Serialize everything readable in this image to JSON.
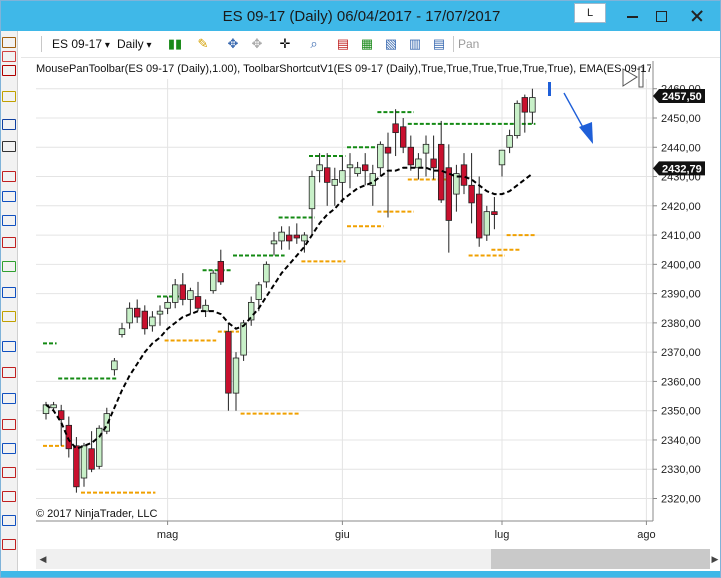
{
  "window": {
    "title": "ES 09-17 (Daily)  06/04/2017 - 17/07/2017",
    "scroll_lock_label": "L"
  },
  "toolbar": {
    "instrument": "ES 09-17",
    "interval": "Daily",
    "pan_label": "Pan"
  },
  "indicators_line": "MousePanToolbar(ES 09-17 (Daily),1.00), ToolbarShortcutV1(ES 09-17 (Daily),True,True,True,True,True,True), EMA(ES 09-17",
  "copyright": "© 2017 NinjaTrader, LLC",
  "colors": {
    "up_candle": "#c8f0c8",
    "down_candle": "#c8102e",
    "resistance": "#138a13",
    "support": "#f0a000",
    "ema": "#000000",
    "arrow": "#1f5fd8",
    "price_flag": "#111111",
    "titlebar": "#3fb8e8"
  },
  "chart_data": {
    "type": "candlestick",
    "title": "",
    "ylim": [
      2315,
      2465
    ],
    "y_ticks": [
      "2320,00",
      "2330,00",
      "2340,00",
      "2350,00",
      "2360,00",
      "2370,00",
      "2380,00",
      "2390,00",
      "2400,00",
      "2410,00",
      "2420,00",
      "2430,00",
      "2440,00",
      "2450,00",
      "2460,00"
    ],
    "x_tick_labels": [
      {
        "label": "mag",
        "index": 16
      },
      {
        "label": "giu",
        "index": 39
      },
      {
        "label": "lug",
        "index": 60
      },
      {
        "label": "ago",
        "index": 79
      }
    ],
    "price_flags": [
      {
        "label": "2457,50",
        "value": 2457.5
      },
      {
        "label": "2432,79",
        "value": 2432.79
      }
    ],
    "candles": [
      [
        2349,
        2353,
        2347,
        2352
      ],
      [
        2351,
        2353,
        2350,
        2352
      ],
      [
        2350,
        2352,
        2338,
        2347
      ],
      [
        2345,
        2348,
        2334,
        2337
      ],
      [
        2338,
        2341,
        2322,
        2324
      ],
      [
        2327,
        2339,
        2324,
        2338
      ],
      [
        2337,
        2343,
        2329,
        2330
      ],
      [
        2331,
        2345,
        2330,
        2344
      ],
      [
        2343,
        2351,
        2342,
        2349
      ],
      [
        2364,
        2368,
        2362,
        2367
      ],
      [
        2376,
        2380,
        2375,
        2378
      ],
      [
        2380,
        2387,
        2378,
        2385
      ],
      [
        2385,
        2388,
        2380,
        2382
      ],
      [
        2384,
        2386,
        2376,
        2378
      ],
      [
        2379,
        2384,
        2377,
        2382
      ],
      [
        2383,
        2386,
        2379,
        2384
      ],
      [
        2385,
        2389,
        2383,
        2387
      ],
      [
        2387,
        2395,
        2385,
        2393
      ],
      [
        2393,
        2397,
        2386,
        2388
      ],
      [
        2388,
        2392,
        2383,
        2391
      ],
      [
        2389,
        2394,
        2384,
        2385
      ],
      [
        2384,
        2388,
        2382,
        2386
      ],
      [
        2391,
        2398,
        2390,
        2397
      ],
      [
        2401,
        2405,
        2393,
        2394
      ],
      [
        2377,
        2380,
        2350,
        2356
      ],
      [
        2356,
        2370,
        2350,
        2368
      ],
      [
        2369,
        2381,
        2367,
        2380
      ],
      [
        2381,
        2389,
        2379,
        2387
      ],
      [
        2388,
        2394,
        2384,
        2393
      ],
      [
        2394,
        2401,
        2392,
        2400
      ],
      [
        2407,
        2411,
        2403,
        2408
      ],
      [
        2408,
        2413,
        2405,
        2411
      ],
      [
        2410,
        2413,
        2405,
        2408
      ],
      [
        2410,
        2414,
        2407,
        2409
      ],
      [
        2408,
        2411,
        2404,
        2410
      ],
      [
        2419,
        2432,
        2410,
        2430
      ],
      [
        2432,
        2438,
        2428,
        2434
      ],
      [
        2433,
        2438,
        2420,
        2428
      ],
      [
        2427,
        2433,
        2420,
        2429
      ],
      [
        2428,
        2437,
        2421,
        2432
      ],
      [
        2433,
        2438,
        2426,
        2434
      ],
      [
        2431,
        2435,
        2430,
        2433
      ],
      [
        2434,
        2438,
        2427,
        2432
      ],
      [
        2427,
        2434,
        2420,
        2431
      ],
      [
        2433,
        2442,
        2430,
        2441
      ],
      [
        2440,
        2445,
        2416,
        2438
      ],
      [
        2448,
        2453,
        2437,
        2445
      ],
      [
        2447,
        2450,
        2438,
        2440
      ],
      [
        2440,
        2444,
        2432,
        2434
      ],
      [
        2433,
        2438,
        2429,
        2436
      ],
      [
        2438,
        2444,
        2430,
        2441
      ],
      [
        2436,
        2444,
        2429,
        2433
      ],
      [
        2441,
        2449,
        2421,
        2422
      ],
      [
        2433,
        2441,
        2404,
        2415
      ],
      [
        2424,
        2434,
        2418,
        2431
      ],
      [
        2434,
        2438,
        2424,
        2427
      ],
      [
        2427,
        2438,
        2414,
        2421
      ],
      [
        2424,
        2430,
        2406,
        2409
      ],
      [
        2410,
        2420,
        2408,
        2418
      ],
      [
        2418,
        2423,
        2412,
        2417
      ],
      [
        2434,
        2438,
        2430,
        2439
      ],
      [
        2440,
        2446,
        2438,
        2444
      ],
      [
        2444,
        2456,
        2443,
        2455
      ],
      [
        2457,
        2458,
        2445,
        2452
      ],
      [
        2452,
        2460,
        2448,
        2457
      ]
    ],
    "ema": [
      2352,
      2350,
      2346,
      2340,
      2337,
      2338,
      2339,
      2341,
      2345,
      2351,
      2357,
      2362,
      2366,
      2370,
      2373,
      2375,
      2378,
      2380,
      2382,
      2383,
      2384,
      2384,
      2384,
      2383,
      2380,
      2378,
      2379,
      2382,
      2385,
      2389,
      2393,
      2397,
      2400,
      2403,
      2406,
      2410,
      2414,
      2417,
      2419,
      2422,
      2424,
      2426,
      2427,
      2428,
      2430,
      2432,
      2432,
      2433,
      2433,
      2433,
      2433,
      2432,
      2432,
      2431,
      2430,
      2430,
      2429,
      2427,
      2425,
      2424,
      2424,
      2425,
      2427,
      2429,
      2431
    ],
    "resistance_segments": [
      {
        "value": 2373,
        "from": 0,
        "to": 1
      },
      {
        "value": 2361,
        "from": 2,
        "to": 9
      },
      {
        "value": 2389,
        "from": 15,
        "to": 18
      },
      {
        "value": 2398,
        "from": 21,
        "to": 24
      },
      {
        "value": 2403,
        "from": 25,
        "to": 31
      },
      {
        "value": 2416,
        "from": 31,
        "to": 35
      },
      {
        "value": 2437,
        "from": 35,
        "to": 39
      },
      {
        "value": 2440,
        "from": 40,
        "to": 44
      },
      {
        "value": 2452,
        "from": 44,
        "to": 48
      },
      {
        "value": 2448,
        "from": 48,
        "to": 64
      }
    ],
    "support_segments": [
      {
        "value": 2338,
        "from": 0,
        "to": 2
      },
      {
        "value": 2322,
        "from": 5,
        "to": 14
      },
      {
        "value": 2374,
        "from": 16,
        "to": 22
      },
      {
        "value": 2377,
        "from": 23,
        "to": 25
      },
      {
        "value": 2349,
        "from": 26,
        "to": 33
      },
      {
        "value": 2401,
        "from": 34,
        "to": 39
      },
      {
        "value": 2413,
        "from": 40,
        "to": 44
      },
      {
        "value": 2418,
        "from": 44,
        "to": 48
      },
      {
        "value": 2429,
        "from": 48,
        "to": 53
      },
      {
        "value": 2403,
        "from": 56,
        "to": 60
      },
      {
        "value": 2405,
        "from": 59,
        "to": 62
      },
      {
        "value": 2410,
        "from": 61,
        "to": 64
      }
    ]
  }
}
